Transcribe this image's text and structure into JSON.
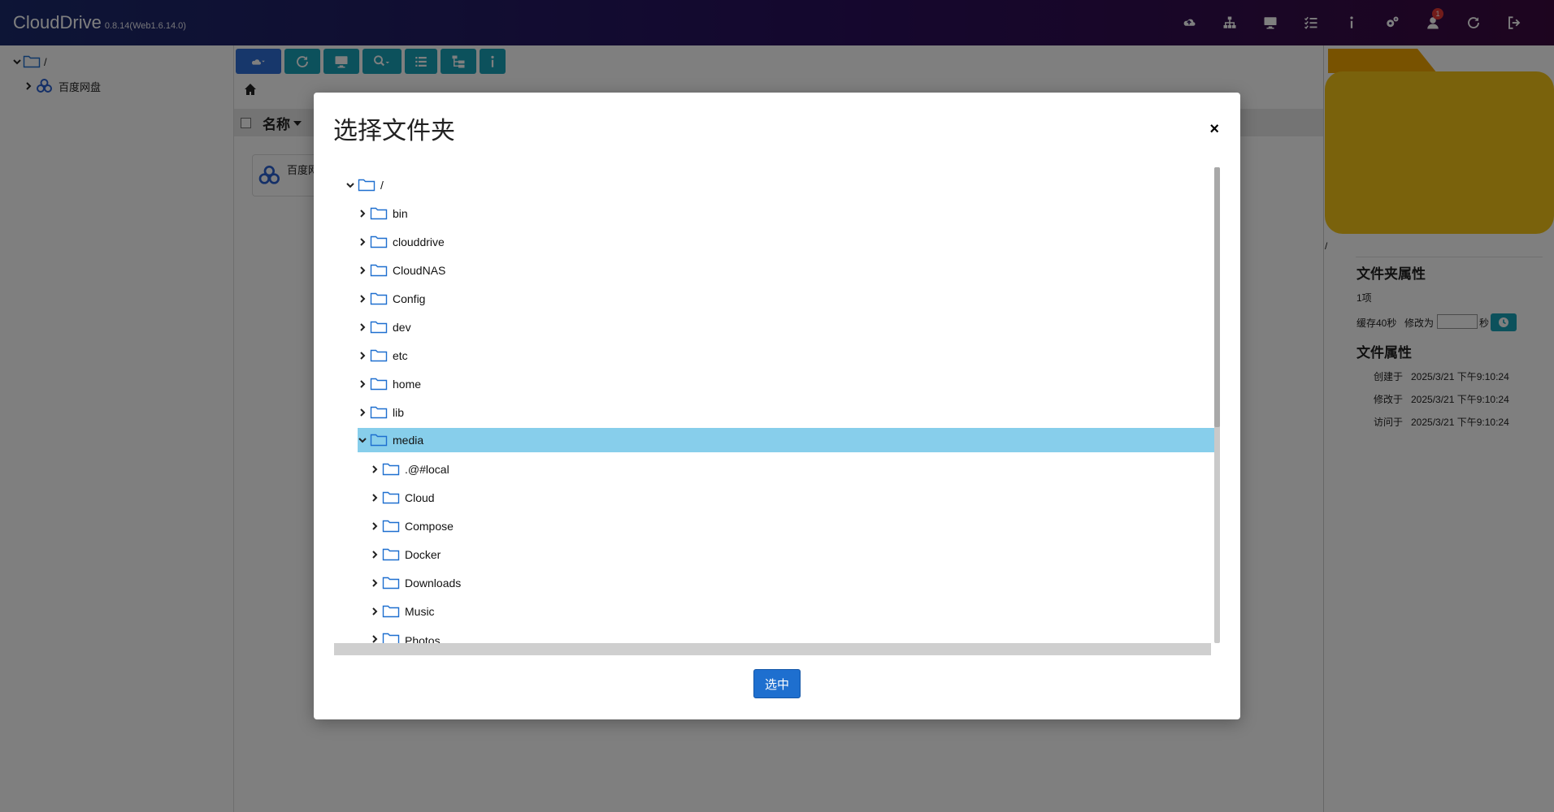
{
  "app": {
    "title": "CloudDrive",
    "version": "0.8.14(Web1.6.14.0)"
  },
  "navbar": {
    "icons": [
      "cloud-upload-icon",
      "network-icon",
      "monitor-icon",
      "tasks-icon",
      "info-icon",
      "settings-icon",
      "user-icon",
      "refresh-icon",
      "logout-icon"
    ],
    "notification_count": "1"
  },
  "left_tree": {
    "root_label": "/",
    "items": [
      {
        "label": "百度网盘",
        "icon": "baidu-icon"
      }
    ]
  },
  "toolbar": {
    "buttons": [
      "cloud-menu-button",
      "refresh-button",
      "monitor-button",
      "search-menu-button",
      "list-view-button",
      "tree-view-button",
      "info-button"
    ]
  },
  "file_list": {
    "header_label": "名称",
    "tile_label": "百度网"
  },
  "right_panel": {
    "path": "/",
    "folder_props_title": "文件夹属性",
    "item_count": "1项",
    "cache_label": "缓存40秒",
    "modify_label": "修改为",
    "seconds_label": "秒",
    "file_props_title": "文件属性",
    "props": [
      {
        "label": "创建于",
        "value": "2025/3/21 下午9:10:24"
      },
      {
        "label": "修改于",
        "value": "2025/3/21 下午9:10:24"
      },
      {
        "label": "访问于",
        "value": "2025/3/21 下午9:10:24"
      }
    ]
  },
  "modal": {
    "title": "选择文件夹",
    "close_label": "×",
    "tree": {
      "root": "/",
      "level1": [
        "bin",
        "clouddrive",
        "CloudNAS",
        "Config",
        "dev",
        "etc",
        "home",
        "lib",
        "media"
      ],
      "selected": "media",
      "level2": [
        ".@#local",
        "Cloud",
        "Compose",
        "Docker",
        "Downloads",
        "Music",
        "Photos"
      ]
    },
    "select_button": "选中"
  },
  "colors": {
    "navbar_start": "#1a2a6c",
    "navbar_end": "#3b0a3f",
    "toolbar_button": "#18a2b8",
    "selected_row": "#87ceeb",
    "primary_button": "#1e6fcf",
    "folder_outline": "#1e6fcf",
    "big_folder": "#f5c518"
  }
}
